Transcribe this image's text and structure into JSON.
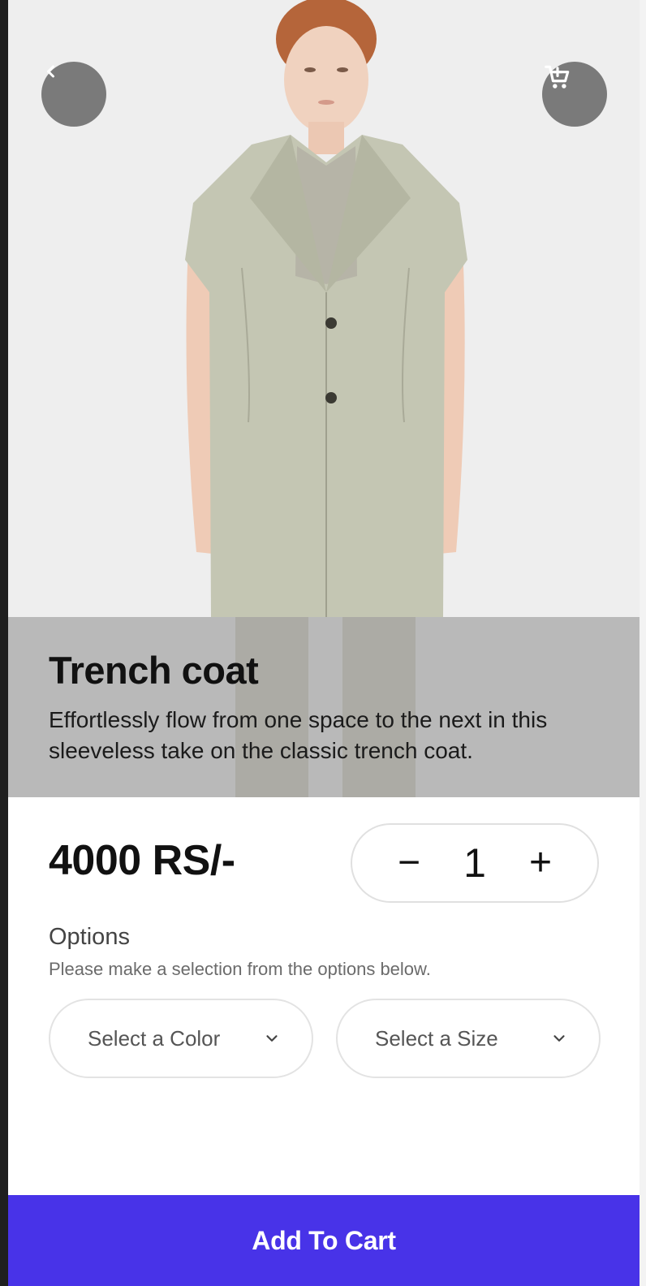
{
  "product": {
    "title": "Trench coat",
    "description": "Effortlessly flow from one space to the next in this sleeveless take on the classic trench coat.",
    "price": "4000 RS/-",
    "quantity": "1"
  },
  "quantity": {
    "decrement_label": "−",
    "increment_label": "+"
  },
  "options": {
    "title": "Options",
    "hint": "Please make a selection from the options below.",
    "color_placeholder": "Select a Color",
    "size_placeholder": "Select a Size"
  },
  "actions": {
    "add_to_cart_label": "Add To Cart"
  },
  "icons": {
    "back": "chevron-left-icon",
    "cart": "shopping-cart-icon",
    "dropdown": "chevron-down-icon"
  },
  "colors": {
    "accent": "#4833e8",
    "overlay_button": "#7a7a7a",
    "coat": "#c4c6b3"
  }
}
